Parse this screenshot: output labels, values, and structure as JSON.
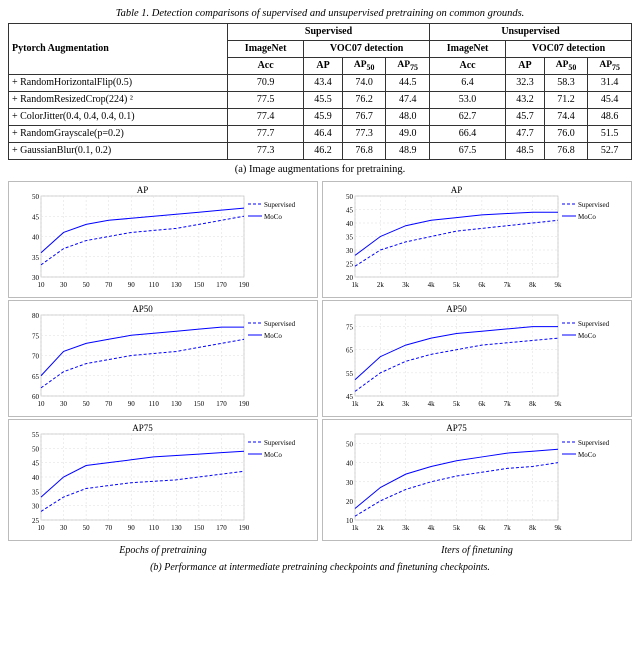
{
  "table": {
    "title": "Table 1. Detection comparisons of supervised and unsupervised pretraining on common grounds.",
    "headers": {
      "aug_col": "Pytorch Augmentation",
      "supervised": "Supervised",
      "unsupervised": "Unsupervised",
      "imagenet": "ImageNet",
      "voc07": "VOC07 detection",
      "acc": "Acc",
      "ap": "AP",
      "ap50": "AP50",
      "ap75": "AP75"
    },
    "rows": [
      {
        "aug": "+ RandomHorizontalFlip(0.5)",
        "s_acc": "70.9",
        "s_ap": "43.4",
        "s_ap50": "74.0",
        "s_ap75": "44.5",
        "u_acc": "6.4",
        "u_ap": "32.3",
        "u_ap50": "58.3",
        "u_ap75": "31.4"
      },
      {
        "aug": "+ RandomResizedCrop(224) ²",
        "s_acc": "77.5",
        "s_ap": "45.5",
        "s_ap50": "76.2",
        "s_ap75": "47.4",
        "u_acc": "53.0",
        "u_ap": "43.2",
        "u_ap50": "71.2",
        "u_ap75": "45.4"
      },
      {
        "aug": "+ ColorJitter(0.4, 0.4, 0.4, 0.1)",
        "s_acc": "77.4",
        "s_ap": "45.9",
        "s_ap50": "76.7",
        "s_ap75": "48.0",
        "u_acc": "62.7",
        "u_ap": "45.7",
        "u_ap50": "74.4",
        "u_ap75": "48.6"
      },
      {
        "aug": "+ RandomGrayscale(p=0.2)",
        "s_acc": "77.7",
        "s_ap": "46.4",
        "s_ap50": "77.3",
        "s_ap75": "49.0",
        "u_acc": "66.4",
        "u_ap": "47.7",
        "u_ap50": "76.0",
        "u_ap75": "51.5"
      },
      {
        "aug": "+ GaussianBlur(0.1, 0.2)",
        "s_acc": "77.3",
        "s_ap": "46.2",
        "s_ap50": "76.8",
        "s_ap75": "48.9",
        "u_acc": "67.5",
        "u_ap": "48.5",
        "u_ap50": "76.8",
        "u_ap75": "52.7"
      }
    ]
  },
  "caption_a": "(a) Image augmentations for pretraining.",
  "caption_b": "(b) Performance at intermediate pretraining checkpoints and finetuning checkpoints.",
  "charts_left": {
    "x_label": "Epochs of pretraining",
    "x_ticks": [
      "10",
      "30",
      "50",
      "70",
      "90",
      "110",
      "130",
      "150",
      "170",
      "190"
    ],
    "ap": {
      "title": "AP",
      "y_min": 30,
      "y_max": 50,
      "y_ticks": [
        "30",
        "35",
        "40",
        "45",
        "50"
      ],
      "supervised": [
        [
          10,
          33
        ],
        [
          30,
          37
        ],
        [
          50,
          39
        ],
        [
          70,
          40
        ],
        [
          90,
          41
        ],
        [
          110,
          41.5
        ],
        [
          130,
          42
        ],
        [
          150,
          43
        ],
        [
          170,
          44
        ],
        [
          190,
          45
        ]
      ],
      "moco": [
        [
          10,
          36
        ],
        [
          30,
          41
        ],
        [
          50,
          43
        ],
        [
          70,
          44
        ],
        [
          90,
          44.5
        ],
        [
          110,
          45
        ],
        [
          130,
          45.5
        ],
        [
          150,
          46
        ],
        [
          170,
          46.5
        ],
        [
          190,
          47
        ]
      ]
    },
    "ap50": {
      "title": "AP50",
      "y_min": 60,
      "y_max": 80,
      "y_ticks": [
        "60",
        "65",
        "70",
        "75",
        "80"
      ],
      "supervised": [
        [
          10,
          62
        ],
        [
          30,
          66
        ],
        [
          50,
          68
        ],
        [
          70,
          69
        ],
        [
          90,
          70
        ],
        [
          110,
          70.5
        ],
        [
          130,
          71
        ],
        [
          150,
          72
        ],
        [
          170,
          73
        ],
        [
          190,
          74
        ]
      ],
      "moco": [
        [
          10,
          65
        ],
        [
          30,
          71
        ],
        [
          50,
          73
        ],
        [
          70,
          74
        ],
        [
          90,
          75
        ],
        [
          110,
          75.5
        ],
        [
          130,
          76
        ],
        [
          150,
          76.5
        ],
        [
          170,
          77
        ],
        [
          190,
          77
        ]
      ]
    },
    "ap75": {
      "title": "AP75",
      "y_min": 25,
      "y_max": 55,
      "y_ticks": [
        "25",
        "30",
        "35",
        "40",
        "45",
        "50",
        "55"
      ],
      "supervised": [
        [
          10,
          28
        ],
        [
          30,
          33
        ],
        [
          50,
          36
        ],
        [
          70,
          37
        ],
        [
          90,
          38
        ],
        [
          110,
          38.5
        ],
        [
          130,
          39
        ],
        [
          150,
          40
        ],
        [
          170,
          41
        ],
        [
          190,
          42
        ]
      ],
      "moco": [
        [
          10,
          33
        ],
        [
          30,
          40
        ],
        [
          50,
          44
        ],
        [
          70,
          45
        ],
        [
          90,
          46
        ],
        [
          110,
          47
        ],
        [
          130,
          47.5
        ],
        [
          150,
          48
        ],
        [
          170,
          48.5
        ],
        [
          190,
          49
        ]
      ]
    }
  },
  "charts_right": {
    "x_label": "Iters of finetuning",
    "x_ticks": [
      "1k",
      "2k",
      "3k",
      "4k",
      "5k",
      "6k",
      "7k",
      "8k",
      "9k"
    ],
    "ap": {
      "title": "AP",
      "y_min": 20,
      "y_max": 50,
      "y_ticks": [
        "20",
        "25",
        "30",
        "35",
        "40",
        "45",
        "50"
      ],
      "supervised": [
        [
          1,
          24
        ],
        [
          2,
          30
        ],
        [
          3,
          33
        ],
        [
          4,
          35
        ],
        [
          5,
          37
        ],
        [
          6,
          38
        ],
        [
          7,
          39
        ],
        [
          8,
          40
        ],
        [
          9,
          41
        ]
      ],
      "moco": [
        [
          1,
          28
        ],
        [
          2,
          35
        ],
        [
          3,
          39
        ],
        [
          4,
          41
        ],
        [
          5,
          42
        ],
        [
          6,
          43
        ],
        [
          7,
          43.5
        ],
        [
          8,
          44
        ],
        [
          9,
          44
        ]
      ]
    },
    "ap50": {
      "title": "AP50",
      "y_min": 45,
      "y_max": 80,
      "y_ticks": [
        "45",
        "55",
        "65",
        "75"
      ],
      "supervised": [
        [
          1,
          47
        ],
        [
          2,
          55
        ],
        [
          3,
          60
        ],
        [
          4,
          63
        ],
        [
          5,
          65
        ],
        [
          6,
          67
        ],
        [
          7,
          68
        ],
        [
          8,
          69
        ],
        [
          9,
          70
        ]
      ],
      "moco": [
        [
          1,
          52
        ],
        [
          2,
          62
        ],
        [
          3,
          67
        ],
        [
          4,
          70
        ],
        [
          5,
          72
        ],
        [
          6,
          73
        ],
        [
          7,
          74
        ],
        [
          8,
          75
        ],
        [
          9,
          75
        ]
      ]
    },
    "ap75": {
      "title": "AP75",
      "y_min": 10,
      "y_max": 55,
      "y_ticks": [
        "10",
        "20",
        "30",
        "40",
        "50"
      ],
      "supervised": [
        [
          1,
          12
        ],
        [
          2,
          20
        ],
        [
          3,
          26
        ],
        [
          4,
          30
        ],
        [
          5,
          33
        ],
        [
          6,
          35
        ],
        [
          7,
          37
        ],
        [
          8,
          38
        ],
        [
          9,
          40
        ]
      ],
      "moco": [
        [
          1,
          16
        ],
        [
          2,
          27
        ],
        [
          3,
          34
        ],
        [
          4,
          38
        ],
        [
          5,
          41
        ],
        [
          6,
          43
        ],
        [
          7,
          45
        ],
        [
          8,
          46
        ],
        [
          9,
          47
        ]
      ]
    }
  },
  "legend": {
    "supervised": "Supervised",
    "moco": "MoCo"
  }
}
